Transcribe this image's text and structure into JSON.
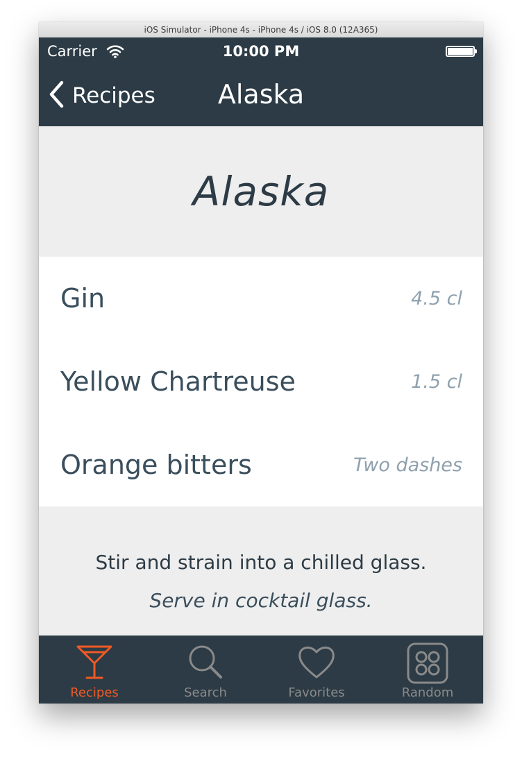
{
  "window": {
    "title": "iOS Simulator - iPhone 4s - iPhone 4s / iOS 8.0 (12A365)"
  },
  "status_bar": {
    "carrier": "Carrier",
    "time": "10:00 PM"
  },
  "nav": {
    "back_label": "Recipes",
    "title": "Alaska"
  },
  "recipe": {
    "title": "Alaska",
    "ingredients": [
      {
        "name": "Gin",
        "amount": "4.5 cl"
      },
      {
        "name": "Yellow Chartreuse",
        "amount": "1.5 cl"
      },
      {
        "name": "Orange bitters",
        "amount": "Two dashes"
      }
    ],
    "method": "Stir and strain into a chilled glass.",
    "serve": "Serve in cocktail glass."
  },
  "tabs": [
    {
      "label": "Recipes",
      "icon": "cocktail-glass-icon",
      "active": true
    },
    {
      "label": "Search",
      "icon": "search-icon",
      "active": false
    },
    {
      "label": "Favorites",
      "icon": "heart-icon",
      "active": false
    },
    {
      "label": "Random",
      "icon": "dice-icon",
      "active": false
    }
  ],
  "colors": {
    "bar_background": "#2c3b45",
    "accent": "#f15a24",
    "inactive_tab": "#8a8a8a",
    "amount_text": "#8fa1ae"
  }
}
